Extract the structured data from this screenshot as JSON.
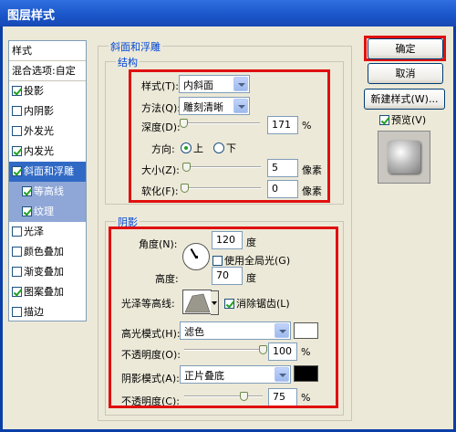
{
  "window": {
    "title": "图层样式"
  },
  "styles_list": {
    "header": "样式",
    "blend_options": "混合选项:自定",
    "items": [
      {
        "label": "投影",
        "checked": true
      },
      {
        "label": "内阴影",
        "checked": false
      },
      {
        "label": "外发光",
        "checked": false
      },
      {
        "label": "内发光",
        "checked": true
      },
      {
        "label": "斜面和浮雕",
        "checked": true,
        "selected": true
      },
      {
        "label": "等高线",
        "checked": true,
        "sub": true
      },
      {
        "label": "纹理",
        "checked": true,
        "sub": true
      },
      {
        "label": "光泽",
        "checked": false
      },
      {
        "label": "颜色叠加",
        "checked": false
      },
      {
        "label": "渐变叠加",
        "checked": false
      },
      {
        "label": "图案叠加",
        "checked": true
      },
      {
        "label": "描边",
        "checked": false
      }
    ]
  },
  "bevel": {
    "group_title": "斜面和浮雕",
    "structure_title": "结构",
    "style_label": "样式(T):",
    "style_value": "内斜面",
    "technique_label": "方法(Q):",
    "technique_value": "雕刻清晰",
    "depth_label": "深度(D):",
    "depth_value": "171",
    "depth_unit": "%",
    "depth_level": 0.04,
    "direction_label": "方向:",
    "direction_up": "上",
    "direction_down": "下",
    "size_label": "大小(Z):",
    "size_value": "5",
    "size_unit": "像素",
    "size_level": 0.02,
    "soften_label": "软化(F):",
    "soften_value": "0",
    "soften_unit": "像素",
    "soften_level": 0.0
  },
  "shading": {
    "group_title": "阴影",
    "angle_label": "角度(N):",
    "angle_value": "120",
    "angle_unit": "度",
    "global_light_label": "使用全局光(G)",
    "global_light_checked": false,
    "altitude_label": "高度:",
    "altitude_value": "70",
    "altitude_unit": "度",
    "gloss_contour_label": "光泽等高线:",
    "anti_aliased_label": "消除锯齿(L)",
    "anti_aliased_checked": true,
    "highlight_mode_label": "高光模式(H):",
    "highlight_mode_value": "滤色",
    "highlight_color": "#ffffff",
    "highlight_opacity_label": "不透明度(O):",
    "highlight_opacity_value": "100",
    "highlight_opacity_unit": "%",
    "highlight_opacity_level": 1.0,
    "shadow_mode_label": "阴影模式(A):",
    "shadow_mode_value": "正片叠底",
    "shadow_color": "#000000",
    "shadow_opacity_label": "不透明度(C):",
    "shadow_opacity_value": "75",
    "shadow_opacity_unit": "%",
    "shadow_opacity_level": 0.75
  },
  "buttons": {
    "ok": "确定",
    "cancel": "取消",
    "new_style": "新建样式(W)...",
    "preview": "预览(V)"
  },
  "highlight_color": "#e01010"
}
